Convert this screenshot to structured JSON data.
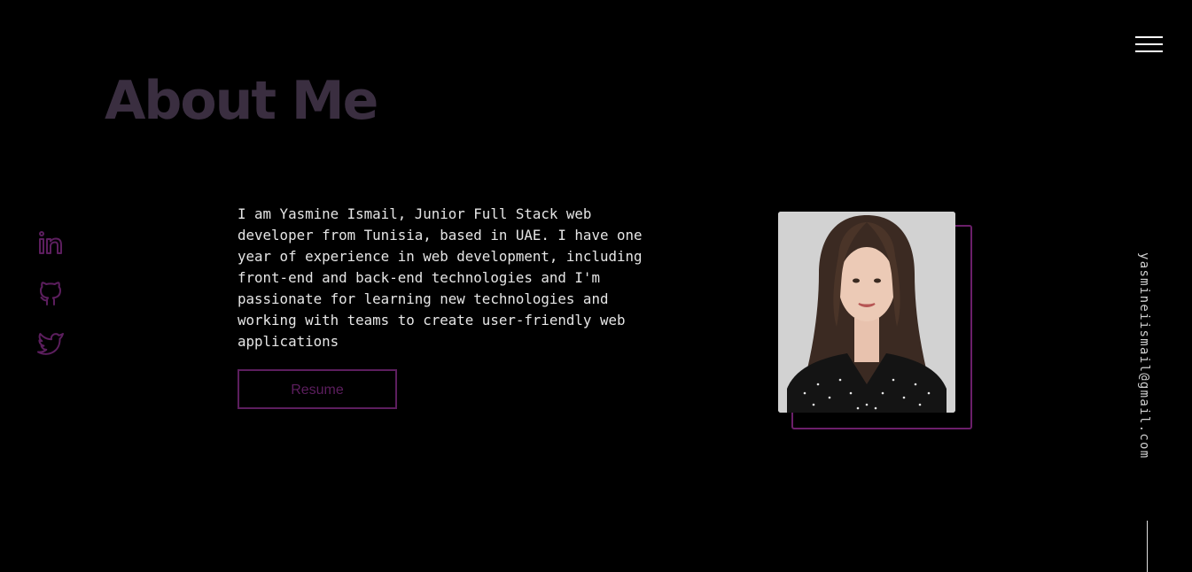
{
  "header": {
    "menu_icon": "hamburger-menu-icon"
  },
  "about": {
    "title": "About Me",
    "bio": "I am Yasmine Ismail, Junior Full Stack web developer from Tunisia, based in UAE. I have one year of experience in web development, including front-end and back-end technologies and I'm passionate for learning new technologies and working with teams to create user-friendly web applications",
    "resume_label": "Resume",
    "photo_icon": "profile-photo"
  },
  "social": {
    "items": [
      {
        "name": "linkedin",
        "icon": "linkedin-icon"
      },
      {
        "name": "github",
        "icon": "github-icon"
      },
      {
        "name": "twitter",
        "icon": "twitter-icon"
      }
    ]
  },
  "contact": {
    "email": "yasmineiismail@gmail.com"
  },
  "colors": {
    "background": "#000000",
    "title": "#3a2e40",
    "accent": "#5c1e5e",
    "text": "#e6e6e6"
  }
}
